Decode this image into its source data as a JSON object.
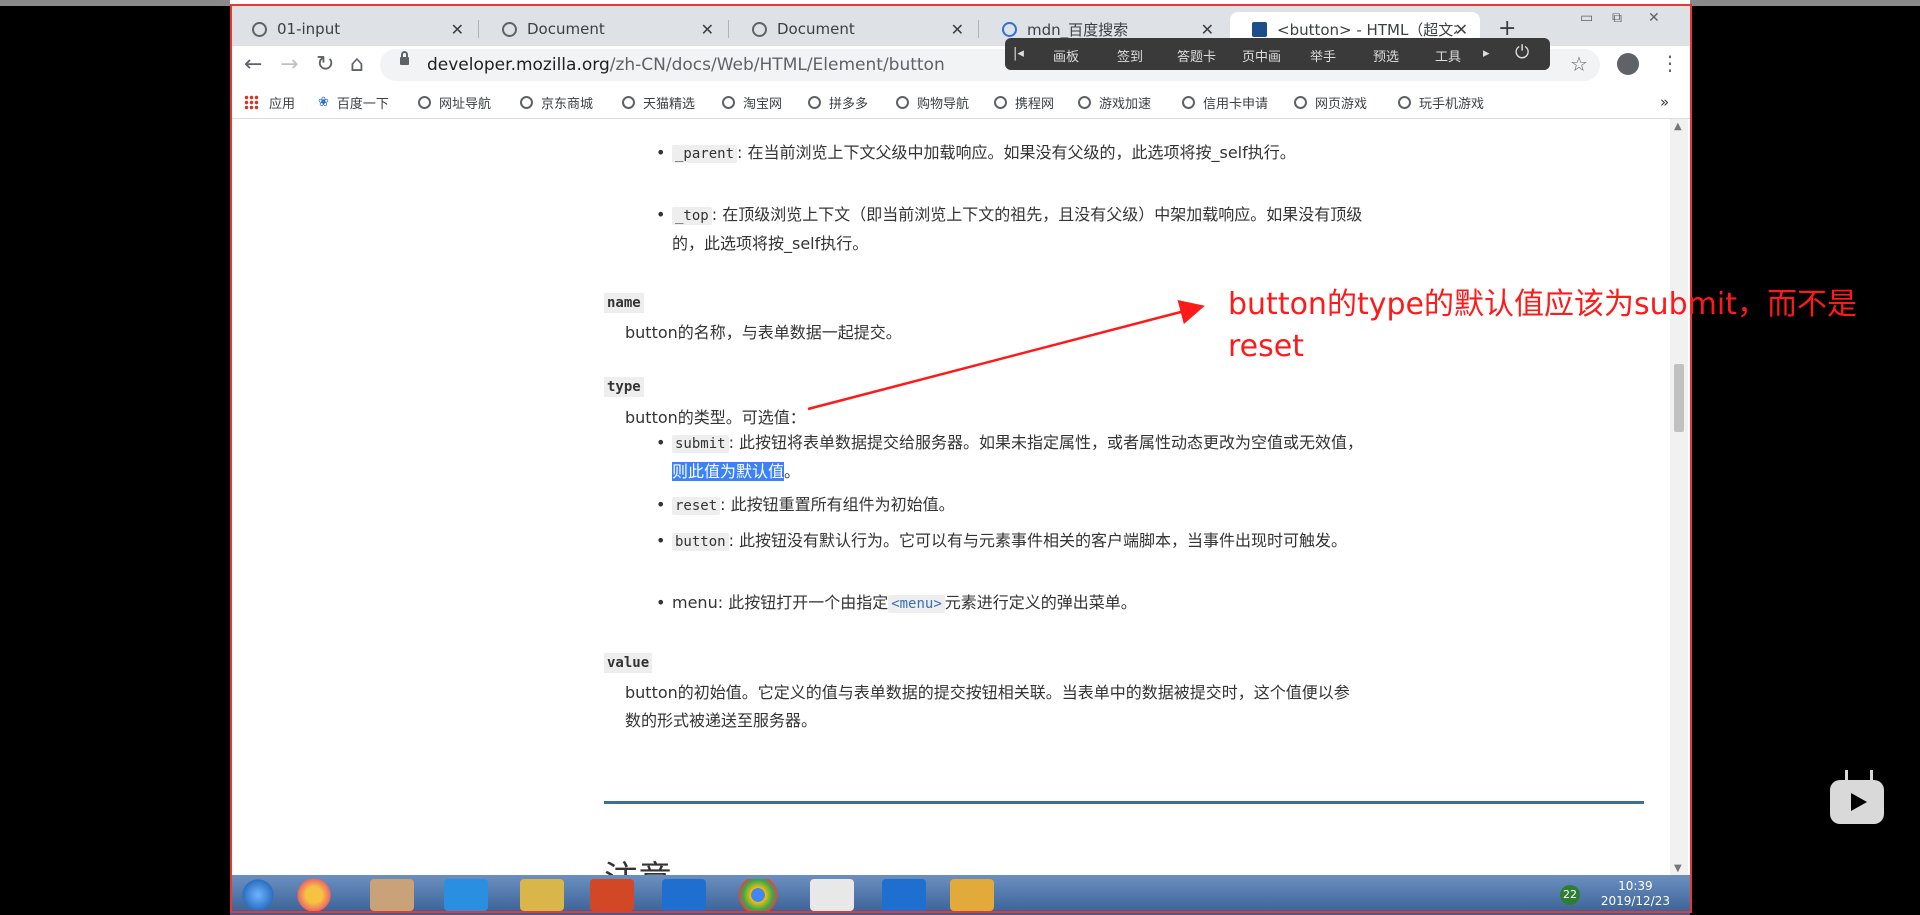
{
  "tabs": [
    {
      "title": "01-input"
    },
    {
      "title": "Document"
    },
    {
      "title": "Document"
    },
    {
      "title": "mdn_百度搜索"
    },
    {
      "title": "<button> - HTML（超文本"
    }
  ],
  "new_tab_label": "+",
  "address": {
    "host": "developer.mozilla.org",
    "path": "/zh-CN/docs/Web/HTML/Element/button"
  },
  "overlay_toolbar": [
    "画板",
    "签到",
    "答题卡",
    "页中画",
    "举手",
    "预选",
    "工具"
  ],
  "bookmarks": [
    "应用",
    "百度一下",
    "网址导航",
    "京东商城",
    "天猫精选",
    "淘宝网",
    "拼多多",
    "购物导航",
    "携程网",
    "游戏加速",
    "信用卡申请",
    "网页游戏",
    "玩手机游戏"
  ],
  "bookmarks_more": "»",
  "doc": {
    "parent_code": "_parent",
    "parent_text": ": 在当前浏览上下文父级中加载响应。如果没有父级的，此选项将按_self执行。",
    "top_code": "_top",
    "top_text": ": 在顶级浏览上下文（即当前浏览上下文的祖先，且没有父级）中架加载响应。如果没有顶级的，此选项将按_self执行。",
    "name_term": "name",
    "name_desc": "button的名称，与表单数据一起提交。",
    "type_term": "type",
    "type_desc": "button的类型。可选值：",
    "submit_code": "submit",
    "submit_text": ": 此按钮将表单数据提交给服务器。如果未指定属性，或者属性动态更改为空值或无效值，",
    "submit_highlight": "则此值为默认值",
    "submit_end": "。",
    "reset_code": "reset",
    "reset_text": ": 此按钮重置所有组件为初始值。",
    "button_code": "button",
    "button_text": ": 此按钮没有默认行为。它可以有与元素事件相关的客户端脚本，当事件出现时可触发。",
    "menu_text_pre": "menu: 此按钮打开一个由指定",
    "menu_code": "<menu>",
    "menu_text_post": "元素进行定义的弹出菜单。",
    "value_term": "value",
    "value_desc": "button的初始值。它定义的值与表单数据的提交按钮相关联。当表单中的数据被提交时，这个值便以参数的形式被递送至服务器。",
    "next_heading": "注意"
  },
  "annotation": "button的type的默认值应该为submit，而不是reset",
  "taskbar": {
    "time": "10:39",
    "date": "2019/12/23",
    "badge": "22"
  },
  "colors": {
    "annotation": "#ff1a1a",
    "highlight": "#3b82f6",
    "frame_border": "#e53935"
  }
}
